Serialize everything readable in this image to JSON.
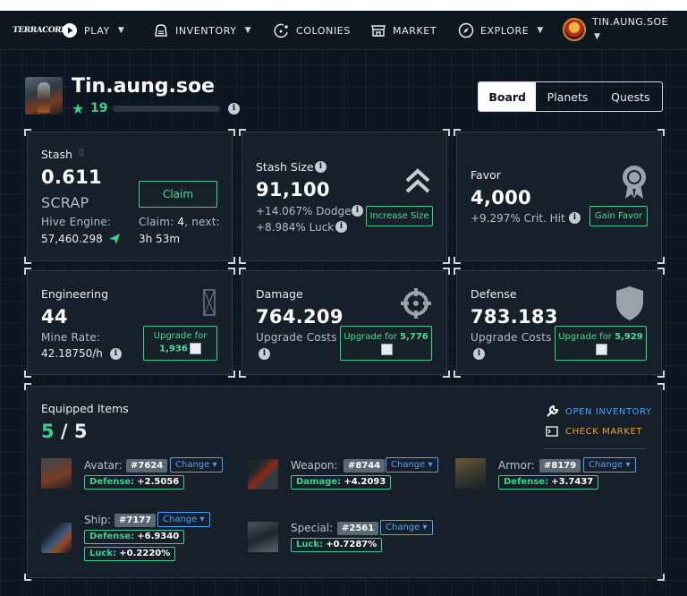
{
  "nav": {
    "logo": "TERRACORE",
    "items": [
      {
        "label": "PLAY",
        "icon": "play-icon",
        "dropdown": true
      },
      {
        "label": "INVENTORY",
        "icon": "inventory-icon",
        "dropdown": true
      },
      {
        "label": "COLONIES",
        "icon": "colonies-icon",
        "dropdown": false
      },
      {
        "label": "MARKET",
        "icon": "market-icon",
        "dropdown": false
      },
      {
        "label": "EXPLORE",
        "icon": "compass-icon",
        "dropdown": true
      }
    ],
    "user": "TIN.AUNG.SOE"
  },
  "profile": {
    "name": "Tin.aung.soe",
    "level": "19",
    "xp_fraction": 0.0
  },
  "tabs": [
    "Board",
    "Planets",
    "Quests"
  ],
  "active_tab": "Board",
  "stash": {
    "label": "Stash",
    "label_glyph": "▯",
    "value": "0.611",
    "unit": "SCRAP",
    "claim_label": "Claim",
    "hive_label": "Hive Engine:",
    "hive_value": "57,460.298",
    "claim_text": "Claim: ",
    "claim_count": "4",
    "claim_next": ", next:",
    "claim_time": "3h 53m"
  },
  "stash_size": {
    "label": "Stash Size",
    "value": "91,100",
    "dodge": "+14.067% Dodge",
    "luck": "+8.984% Luck",
    "button": "Increase Size"
  },
  "favor": {
    "label": "Favor",
    "value": "4,000",
    "crit": "+9.297% Crit. Hit",
    "button": "Gain Favor"
  },
  "engineering": {
    "label": "Engineering",
    "value": "44",
    "rate_label": "Mine Rate:",
    "rate_value": "42.18750/h",
    "button_line1": "Upgrade for",
    "button_cost": "1,936"
  },
  "damage": {
    "label": "Damage",
    "value": "764.209",
    "costs_label": "Upgrade Costs",
    "button_text": "Upgrade for ",
    "button_cost": "5,776"
  },
  "defense": {
    "label": "Defense",
    "value": "783.183",
    "costs_label": "Upgrade Costs",
    "button_text": "Upgrade for ",
    "button_cost": "5,929"
  },
  "equipped": {
    "title": "Equipped Items",
    "count": "5",
    "slash": " / ",
    "total": "5",
    "open_inventory": "OPEN INVENTORY",
    "check_market": "CHECK MARKET",
    "change_label": "Change",
    "items": [
      {
        "slot": "Avatar:",
        "id": "#7624",
        "stats": [
          {
            "k": "Defense:",
            "v": "+2.5056"
          }
        ]
      },
      {
        "slot": "Weapon:",
        "id": "#8744",
        "stats": [
          {
            "k": "Damage:",
            "v": "+4.2093"
          }
        ]
      },
      {
        "slot": "Armor:",
        "id": "#8179",
        "stats": [
          {
            "k": "Defense:",
            "v": "+3.7437"
          }
        ]
      },
      {
        "slot": "Ship:",
        "id": "#7177",
        "stats": [
          {
            "k": "Defense:",
            "v": "+6.9340"
          },
          {
            "k": "Luck:",
            "v": "+0.2220%"
          }
        ]
      },
      {
        "slot": "Special:",
        "id": "#2561",
        "stats": [
          {
            "k": "Luck:",
            "v": "+0.7287%"
          }
        ]
      }
    ]
  },
  "colors": {
    "accent": "#3ecf8e",
    "link_blue": "#4aa3ff",
    "link_orange": "#f0a030",
    "background": "#0c1520"
  }
}
